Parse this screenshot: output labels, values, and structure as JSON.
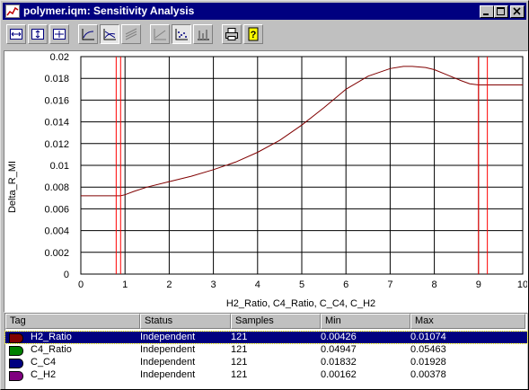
{
  "window": {
    "title": "polymer.iqm: Sensitivity Analysis"
  },
  "toolbar": {
    "buttons": [
      {
        "name": "fit-width-icon"
      },
      {
        "name": "fit-height-icon"
      },
      {
        "name": "fit-all-icon"
      },
      {
        "name": "line-chart-icon"
      },
      {
        "name": "line-range-icon"
      },
      {
        "name": "area-icon"
      },
      {
        "name": "line-plain-icon"
      },
      {
        "name": "scatter-icon"
      },
      {
        "name": "bar-chart-icon"
      },
      {
        "name": "print-icon"
      },
      {
        "name": "help-icon"
      }
    ]
  },
  "chart_data": {
    "type": "line",
    "ylabel": "Delta_R_MI",
    "xlabel": "H2_Ratio, C4_Ratio, C_C4, C_H2",
    "xlim": [
      0,
      10
    ],
    "ylim": [
      0,
      0.02
    ],
    "x_ticks": [
      "0",
      "1",
      "2",
      "3",
      "4",
      "5",
      "6",
      "7",
      "8",
      "9",
      "10"
    ],
    "y_ticks": [
      "0",
      "0.002",
      "0.004",
      "0.006",
      "0.008",
      "0.01",
      "0.012",
      "0.014",
      "0.016",
      "0.018",
      "0.02"
    ],
    "grid": true,
    "series": [
      {
        "color": "#800000",
        "x": [
          0,
          0.5,
          0.9,
          1.0,
          1.2,
          1.5,
          2.0,
          2.5,
          3.0,
          3.5,
          4.0,
          4.5,
          5.0,
          5.5,
          6.0,
          6.5,
          7.0,
          7.3,
          7.5,
          7.8,
          8.0,
          8.3,
          8.6,
          8.8,
          9.0,
          9.2,
          9.6,
          10.0
        ],
        "y": [
          0.0072,
          0.0072,
          0.0072,
          0.0073,
          0.0076,
          0.008,
          0.0085,
          0.009,
          0.0096,
          0.0103,
          0.0112,
          0.0123,
          0.0137,
          0.0153,
          0.017,
          0.0182,
          0.0189,
          0.0191,
          0.0191,
          0.019,
          0.0188,
          0.0183,
          0.0178,
          0.0175,
          0.0174,
          0.0174,
          0.0174,
          0.0174
        ]
      }
    ],
    "vlines": [
      {
        "x": 0.8,
        "color": "#ff0000"
      },
      {
        "x": 0.9,
        "color": "#ff0000"
      },
      {
        "x": 9.0,
        "color": "#ff0000"
      },
      {
        "x": 9.2,
        "color": "#ff0000"
      }
    ]
  },
  "table": {
    "headers": [
      "Tag",
      "Status",
      "Samples",
      "Min",
      "Max"
    ],
    "rows": [
      {
        "tag": "H2_Ratio",
        "color": "#800000",
        "status": "Independent",
        "samples": "121",
        "min": "0.00426",
        "max": "0.01074",
        "selected": true
      },
      {
        "tag": "C4_Ratio",
        "color": "#008000",
        "status": "Independent",
        "samples": "121",
        "min": "0.04947",
        "max": "0.05463",
        "selected": false
      },
      {
        "tag": "C_C4",
        "color": "#000080",
        "status": "Independent",
        "samples": "121",
        "min": "0.01832",
        "max": "0.01928",
        "selected": false
      },
      {
        "tag": "C_H2",
        "color": "#800080",
        "status": "Independent",
        "samples": "121",
        "min": "0.00162",
        "max": "0.00378",
        "selected": false
      }
    ]
  }
}
